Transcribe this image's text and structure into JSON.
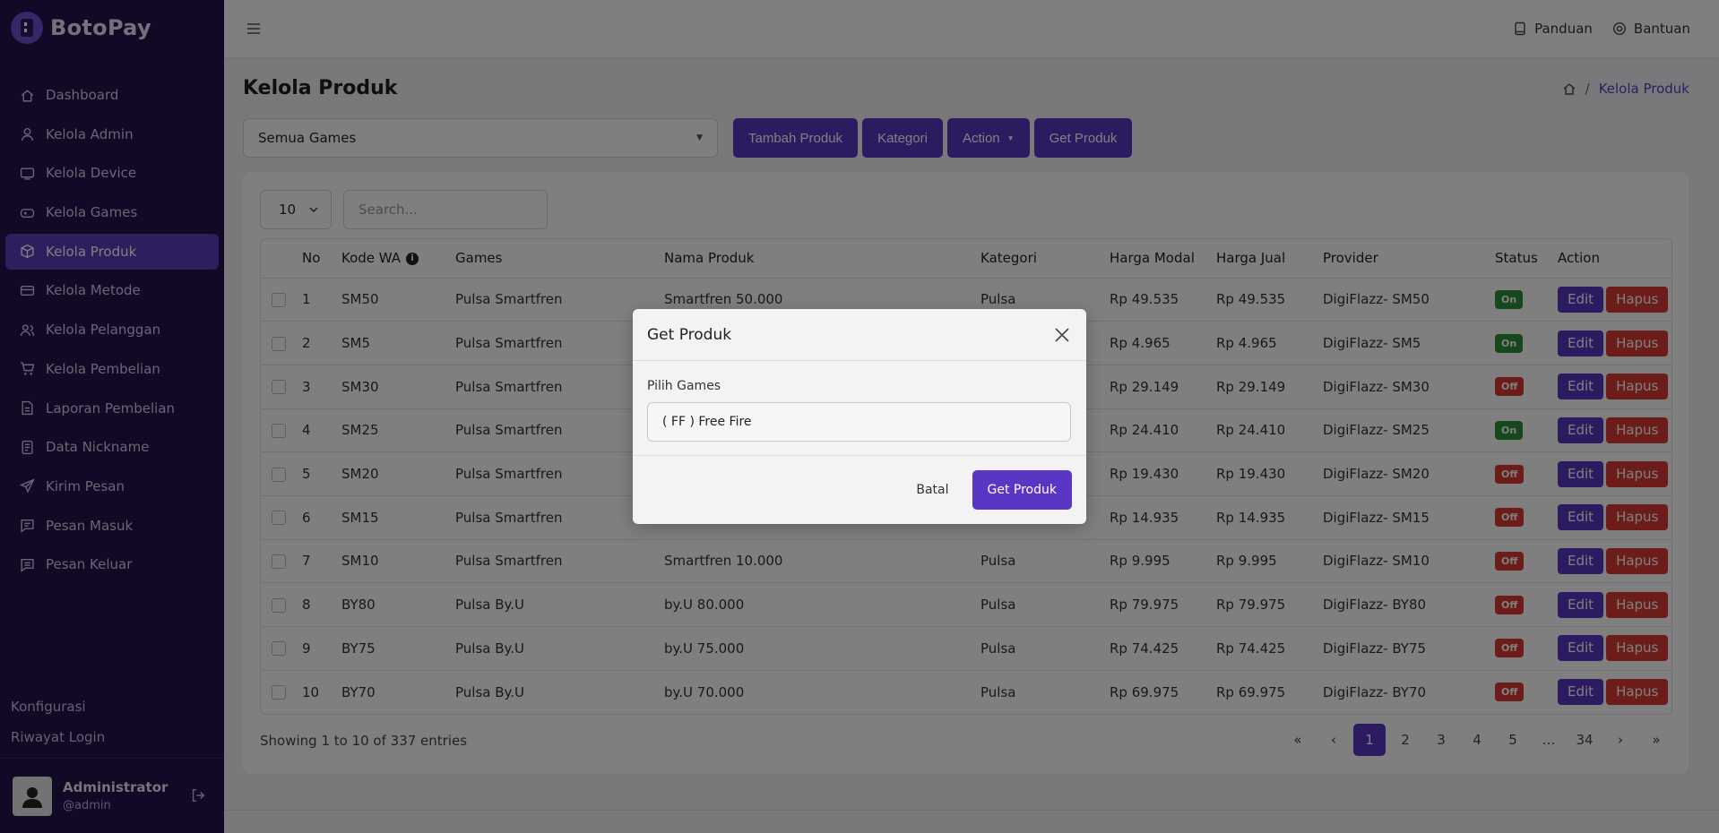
{
  "brand": {
    "name": "BotoPay"
  },
  "sidebar": {
    "items": [
      {
        "label": "Dashboard",
        "icon": "home-icon",
        "active": false
      },
      {
        "label": "Kelola Admin",
        "icon": "user-icon",
        "active": false
      },
      {
        "label": "Kelola Device",
        "icon": "device-icon",
        "active": false
      },
      {
        "label": "Kelola Games",
        "icon": "gamepad-icon",
        "active": false
      },
      {
        "label": "Kelola Produk",
        "icon": "box-icon",
        "active": true
      },
      {
        "label": "Kelola Metode",
        "icon": "card-icon",
        "active": false
      },
      {
        "label": "Kelola Pelanggan",
        "icon": "users-icon",
        "active": false
      },
      {
        "label": "Kelola Pembelian",
        "icon": "cart-icon",
        "active": false
      },
      {
        "label": "Laporan Pembelian",
        "icon": "report-icon",
        "active": false
      },
      {
        "label": "Data Nickname",
        "icon": "database-icon",
        "active": false
      },
      {
        "label": "Kirim Pesan",
        "icon": "send-icon",
        "active": false
      },
      {
        "label": "Pesan Masuk",
        "icon": "message-icon",
        "active": false
      },
      {
        "label": "Pesan Keluar",
        "icon": "message-out-icon",
        "active": false
      }
    ],
    "bottom": [
      "Konfigurasi",
      "Riwayat Login"
    ],
    "user": {
      "name": "Administrator",
      "handle": "@admin"
    }
  },
  "topbar": {
    "panduan": "Panduan",
    "bantuan": "Bantuan"
  },
  "page": {
    "title": "Kelola Produk",
    "breadcrumb_current": "Kelola Produk",
    "filter_value": "Semua Games",
    "buttons": {
      "tambah": "Tambah Produk",
      "kategori": "Kategori",
      "action": "Action",
      "get": "Get Produk"
    }
  },
  "table": {
    "length": "10",
    "search_placeholder": "Search...",
    "headers": [
      "No",
      "Kode WA",
      "Games",
      "Nama Produk",
      "Kategori",
      "Harga Modal",
      "Harga Jual",
      "Provider",
      "Status",
      "Action"
    ],
    "edit_label": "Edit",
    "delete_label": "Hapus",
    "rows": [
      {
        "no": "1",
        "kode": "SM50",
        "games": "Pulsa Smartfren",
        "nama": "Smartfren 50.000",
        "kategori": "Pulsa",
        "modal": "Rp 49.535",
        "jual": "Rp 49.535",
        "provider": "DigiFlazz- SM50",
        "status": "On"
      },
      {
        "no": "2",
        "kode": "SM5",
        "games": "Pulsa Smartfren",
        "nama": "",
        "kategori": "",
        "modal": "Rp 4.965",
        "jual": "Rp 4.965",
        "provider": "DigiFlazz- SM5",
        "status": "On"
      },
      {
        "no": "3",
        "kode": "SM30",
        "games": "Pulsa Smartfren",
        "nama": "",
        "kategori": "",
        "modal": "Rp 29.149",
        "jual": "Rp 29.149",
        "provider": "DigiFlazz- SM30",
        "status": "Off"
      },
      {
        "no": "4",
        "kode": "SM25",
        "games": "Pulsa Smartfren",
        "nama": "",
        "kategori": "",
        "modal": "Rp 24.410",
        "jual": "Rp 24.410",
        "provider": "DigiFlazz- SM25",
        "status": "On"
      },
      {
        "no": "5",
        "kode": "SM20",
        "games": "Pulsa Smartfren",
        "nama": "",
        "kategori": "",
        "modal": "Rp 19.430",
        "jual": "Rp 19.430",
        "provider": "DigiFlazz- SM20",
        "status": "Off"
      },
      {
        "no": "6",
        "kode": "SM15",
        "games": "Pulsa Smartfren",
        "nama": "",
        "kategori": "",
        "modal": "Rp 14.935",
        "jual": "Rp 14.935",
        "provider": "DigiFlazz- SM15",
        "status": "Off"
      },
      {
        "no": "7",
        "kode": "SM10",
        "games": "Pulsa Smartfren",
        "nama": "Smartfren 10.000",
        "kategori": "Pulsa",
        "modal": "Rp 9.995",
        "jual": "Rp 9.995",
        "provider": "DigiFlazz- SM10",
        "status": "Off"
      },
      {
        "no": "8",
        "kode": "BY80",
        "games": "Pulsa By.U",
        "nama": "by.U 80.000",
        "kategori": "Pulsa",
        "modal": "Rp 79.975",
        "jual": "Rp 79.975",
        "provider": "DigiFlazz- BY80",
        "status": "Off"
      },
      {
        "no": "9",
        "kode": "BY75",
        "games": "Pulsa By.U",
        "nama": "by.U 75.000",
        "kategori": "Pulsa",
        "modal": "Rp 74.425",
        "jual": "Rp 74.425",
        "provider": "DigiFlazz- BY75",
        "status": "Off"
      },
      {
        "no": "10",
        "kode": "BY70",
        "games": "Pulsa By.U",
        "nama": "by.U 70.000",
        "kategori": "Pulsa",
        "modal": "Rp 69.975",
        "jual": "Rp 69.975",
        "provider": "DigiFlazz- BY70",
        "status": "Off"
      }
    ],
    "showing": "Showing 1 to 10 of 337 entries",
    "pages": [
      "«",
      "‹",
      "1",
      "2",
      "3",
      "4",
      "5",
      "...",
      "34",
      "›",
      "»"
    ],
    "current_page": "1"
  },
  "modal": {
    "title": "Get Produk",
    "label": "Pilih Games",
    "select_value": "( FF ) Free Fire",
    "cancel": "Batal",
    "submit": "Get Produk"
  },
  "colors": {
    "primary": "#5b36c4",
    "sidebar": "#22124a",
    "danger": "#d93a35",
    "success": "#2f8f3b"
  }
}
